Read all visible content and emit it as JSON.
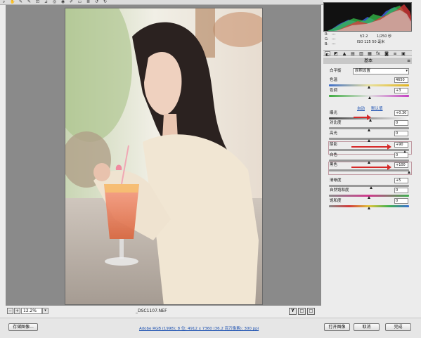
{
  "toolbar": {
    "tools": [
      {
        "icon": "zoom-icon",
        "glyph": "⌕"
      },
      {
        "icon": "hand-icon",
        "glyph": "✋"
      },
      {
        "icon": "white-balance-icon",
        "glyph": "✎"
      },
      {
        "icon": "color-sampler-icon",
        "glyph": "✎"
      },
      {
        "icon": "crop-icon",
        "glyph": "⊡"
      },
      {
        "icon": "straighten-icon",
        "glyph": "⊿"
      },
      {
        "icon": "spot-removal-icon",
        "glyph": "◎"
      },
      {
        "icon": "red-eye-icon",
        "glyph": "◉"
      },
      {
        "icon": "adjustment-brush-icon",
        "glyph": "✐"
      },
      {
        "icon": "graduated-filter-icon",
        "glyph": "▭"
      },
      {
        "icon": "preferences-icon",
        "glyph": "≣"
      },
      {
        "icon": "rotate-left-icon",
        "glyph": "↺"
      },
      {
        "icon": "rotate-right-icon",
        "glyph": "↻"
      }
    ]
  },
  "canvas": {
    "zoom": "12.2%",
    "filename": "_DSC1107.NEF",
    "view_buttons": [
      "Y",
      "□",
      "□"
    ]
  },
  "info": {
    "r": "R:",
    "g": "G:",
    "b": "B:",
    "rv": "---",
    "gv": "---",
    "bv": "---",
    "aperture": "f/2.2",
    "shutter": "1/250 秒",
    "iso_focal": "ISO 125    50 毫米"
  },
  "panel": {
    "title": "基本",
    "menu_glyph": "≡",
    "tabs": [
      {
        "icon": "basic-icon",
        "glyph": "◐"
      },
      {
        "icon": "tone-curve-icon",
        "glyph": "◩"
      },
      {
        "icon": "detail-icon",
        "glyph": "▲"
      },
      {
        "icon": "hsl-icon",
        "glyph": "▤"
      },
      {
        "icon": "split-toning-icon",
        "glyph": "▥"
      },
      {
        "icon": "lens-icon",
        "glyph": "▦"
      },
      {
        "icon": "effects-icon",
        "glyph": "fx"
      },
      {
        "icon": "camera-calibration-icon",
        "glyph": "◙"
      },
      {
        "icon": "presets-icon",
        "glyph": "≡"
      },
      {
        "icon": "snapshots-icon",
        "glyph": "▣"
      }
    ],
    "white_balance": {
      "label": "白平衡",
      "value": "原照设置"
    },
    "auto_label": "自动",
    "default_label": "默认值",
    "sliders": [
      {
        "label": "色温",
        "value": "4650",
        "pos": 0.5,
        "track": "linear-gradient(90deg,#3f6fc9,#e8e1a0,#e1b41f)"
      },
      {
        "label": "色调",
        "value": "+3",
        "pos": 0.51,
        "track": "linear-gradient(90deg,#3dab3f,#e1e1e1,#c43fc2)"
      },
      {
        "label": "曝光",
        "value": "+0.30",
        "pos": 0.52,
        "track": "linear-gradient(90deg,#444,#f4f4f4)"
      },
      {
        "label": "对比度",
        "value": "0",
        "pos": 0.5,
        "track": "linear-gradient(90deg,#999,#999)"
      },
      {
        "label": "高光",
        "value": "0",
        "pos": 0.5,
        "track": "linear-gradient(90deg,#999,#999)"
      },
      {
        "label": "阴影",
        "value": "+90",
        "pos": 0.95,
        "track": "linear-gradient(90deg,#999,#999)"
      },
      {
        "label": "白色",
        "value": "0",
        "pos": 0.5,
        "track": "linear-gradient(90deg,#999,#999)"
      },
      {
        "label": "黑色",
        "value": "+100",
        "pos": 1.0,
        "track": "linear-gradient(90deg,#999,#999)"
      },
      {
        "label": "清晰度",
        "value": "+5",
        "pos": 0.53,
        "track": "linear-gradient(90deg,#999,#999)"
      },
      {
        "label": "自然饱和度",
        "value": "0",
        "pos": 0.5,
        "track": "linear-gradient(90deg,#8a8a8a,#d23a8e,#3fb04f)"
      },
      {
        "label": "饱和度",
        "value": "0",
        "pos": 0.5,
        "track": "linear-gradient(90deg,#8a8a8a,#d23a3a,#e0c43a,#3fb04f,#3a6fd2)"
      }
    ]
  },
  "footer": {
    "save_label": "存储图像...",
    "workflow": "Adobe RGB (1998); 8 位; 4912 x 7360 (36.2 百万像素); 300 ppi",
    "open_label": "打开图像",
    "cancel_label": "取消",
    "done_label": "完成"
  }
}
